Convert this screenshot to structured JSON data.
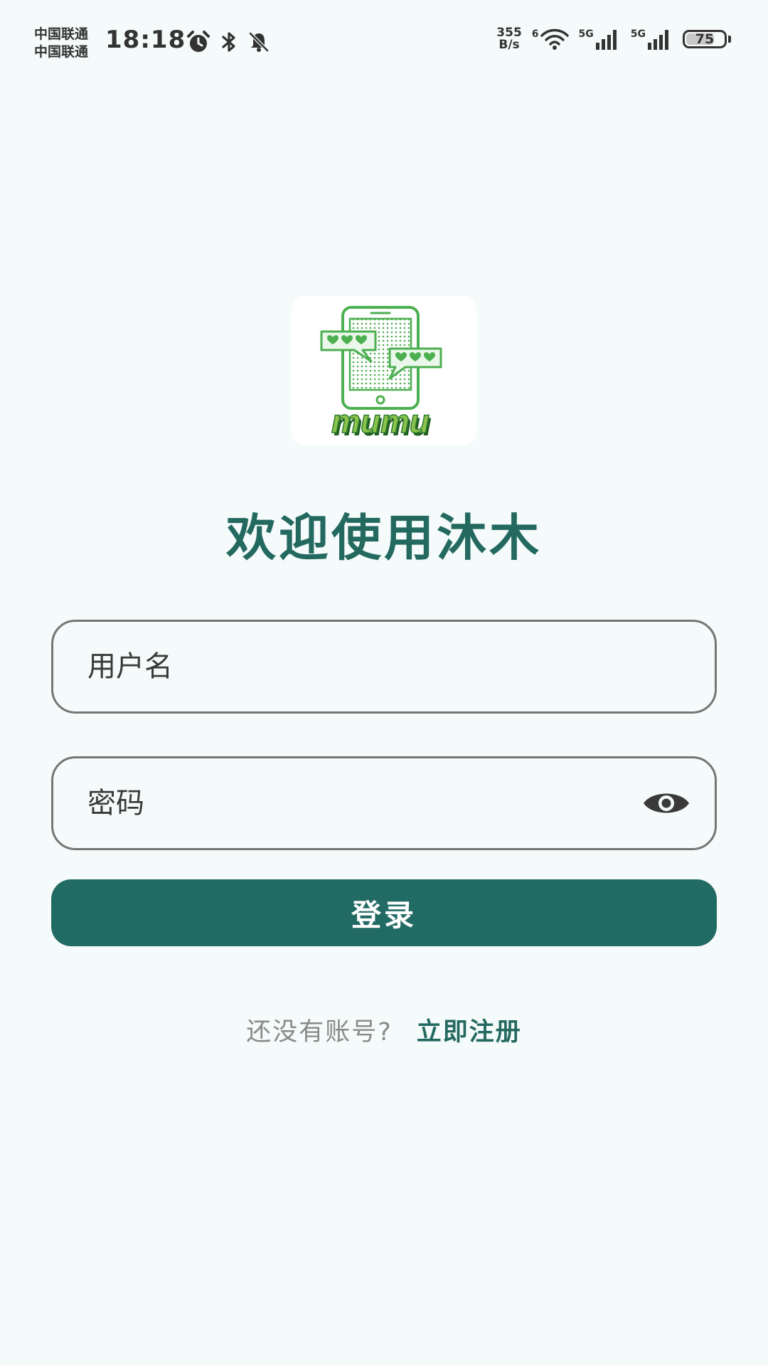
{
  "status_bar": {
    "carrier_1": "中国联通",
    "carrier_2": "中国联通",
    "time": "18:18",
    "net_speed_value": "355",
    "net_speed_unit": "B/s",
    "wifi_tag": "6",
    "signal_1_tag": "5G",
    "signal_2_tag": "5G",
    "battery_level": "75",
    "battery_fraction": 0.75,
    "icons": [
      "alarm-icon",
      "bluetooth-icon",
      "mute-icon",
      "wifi-icon",
      "signal-icon",
      "battery-icon"
    ]
  },
  "logo": {
    "wordmark": "mumu",
    "brand_color": "#4caf50"
  },
  "welcome_title": "欢迎使用沐木",
  "form": {
    "username_placeholder": "用户名",
    "password_placeholder": "密码",
    "password_toggle_icon": "eye-icon",
    "login_label": "登录"
  },
  "register": {
    "prompt": "还没有账号?",
    "link_label": "立即注册"
  },
  "colors": {
    "accent": "#226a64",
    "background": "#f4fbfa",
    "field_border": "#767676",
    "muted_text": "#8a8a8a"
  }
}
